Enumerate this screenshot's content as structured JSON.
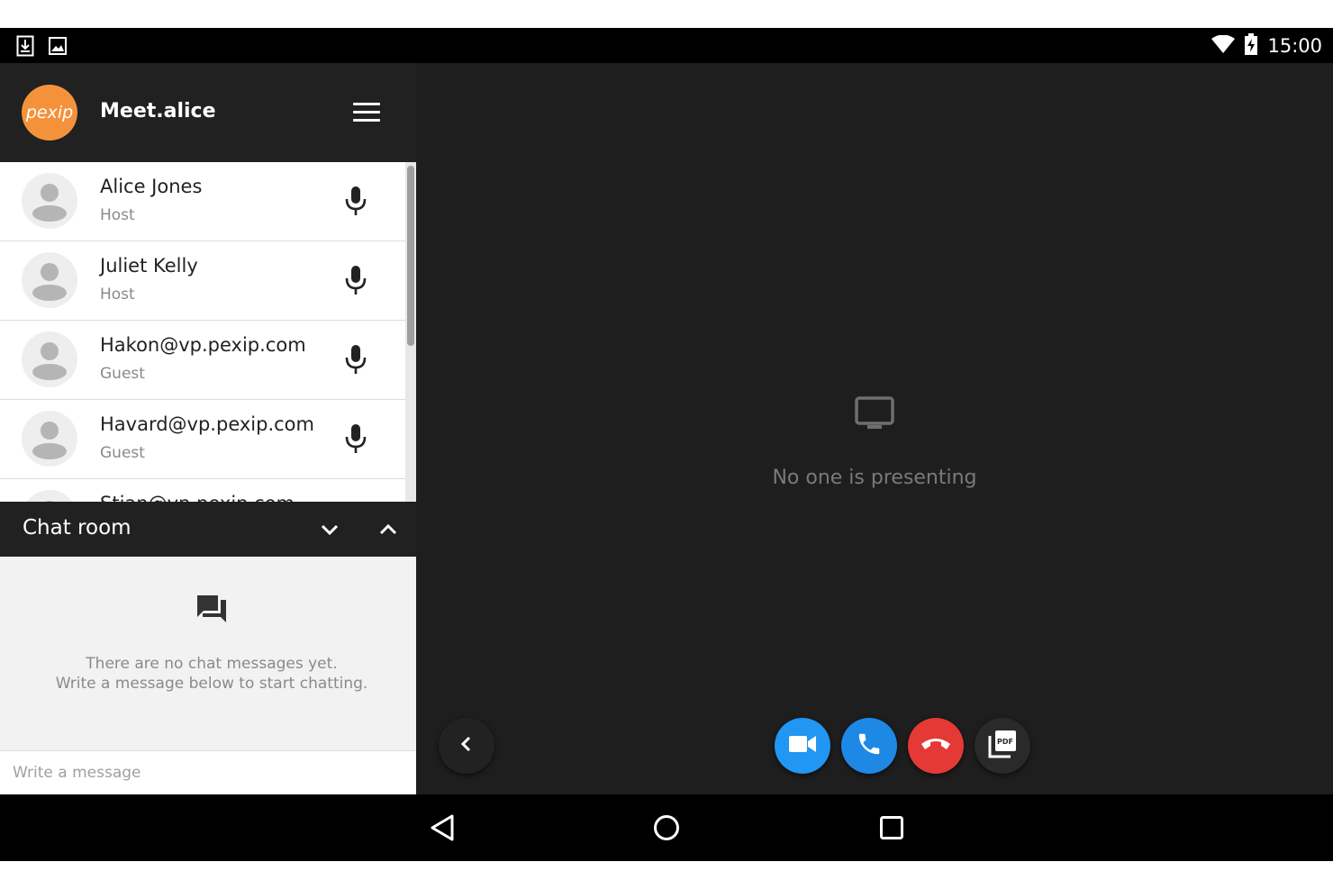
{
  "status_bar": {
    "time": "15:00",
    "left_icons": [
      "download-icon",
      "image-icon"
    ],
    "right_icons": [
      "wifi-icon",
      "battery-charging-icon"
    ]
  },
  "app_bar": {
    "logo_text": "pexip",
    "title": "Meet.alice",
    "menu_icon": "hamburger-menu-icon"
  },
  "participants": [
    {
      "name": "Alice Jones",
      "role": "Host"
    },
    {
      "name": "Juliet Kelly",
      "role": "Host"
    },
    {
      "name": "Hakon@vp.pexip.com",
      "role": "Guest"
    },
    {
      "name": "Havard@vp.pexip.com",
      "role": "Guest"
    },
    {
      "name": "Stian@vp.pexip.com",
      "role": ""
    }
  ],
  "chat": {
    "title": "Chat room",
    "empty_line1": "There are no chat messages yet.",
    "empty_line2": "Write a message below to start chatting.",
    "input_placeholder": "Write a message"
  },
  "presentation": {
    "status_text": "No one is presenting"
  },
  "controls": {
    "buttons": [
      "video-camera-icon",
      "phone-icon",
      "hang-up-icon",
      "pdf-icon"
    ],
    "colors": {
      "video": "#2196f3",
      "audio": "#1e88e5",
      "hangup": "#e53935",
      "pdf": "#2a2a2a"
    }
  },
  "colors": {
    "brand": "#f4923c",
    "appbar": "#212121",
    "background": "#1e1e1e"
  }
}
